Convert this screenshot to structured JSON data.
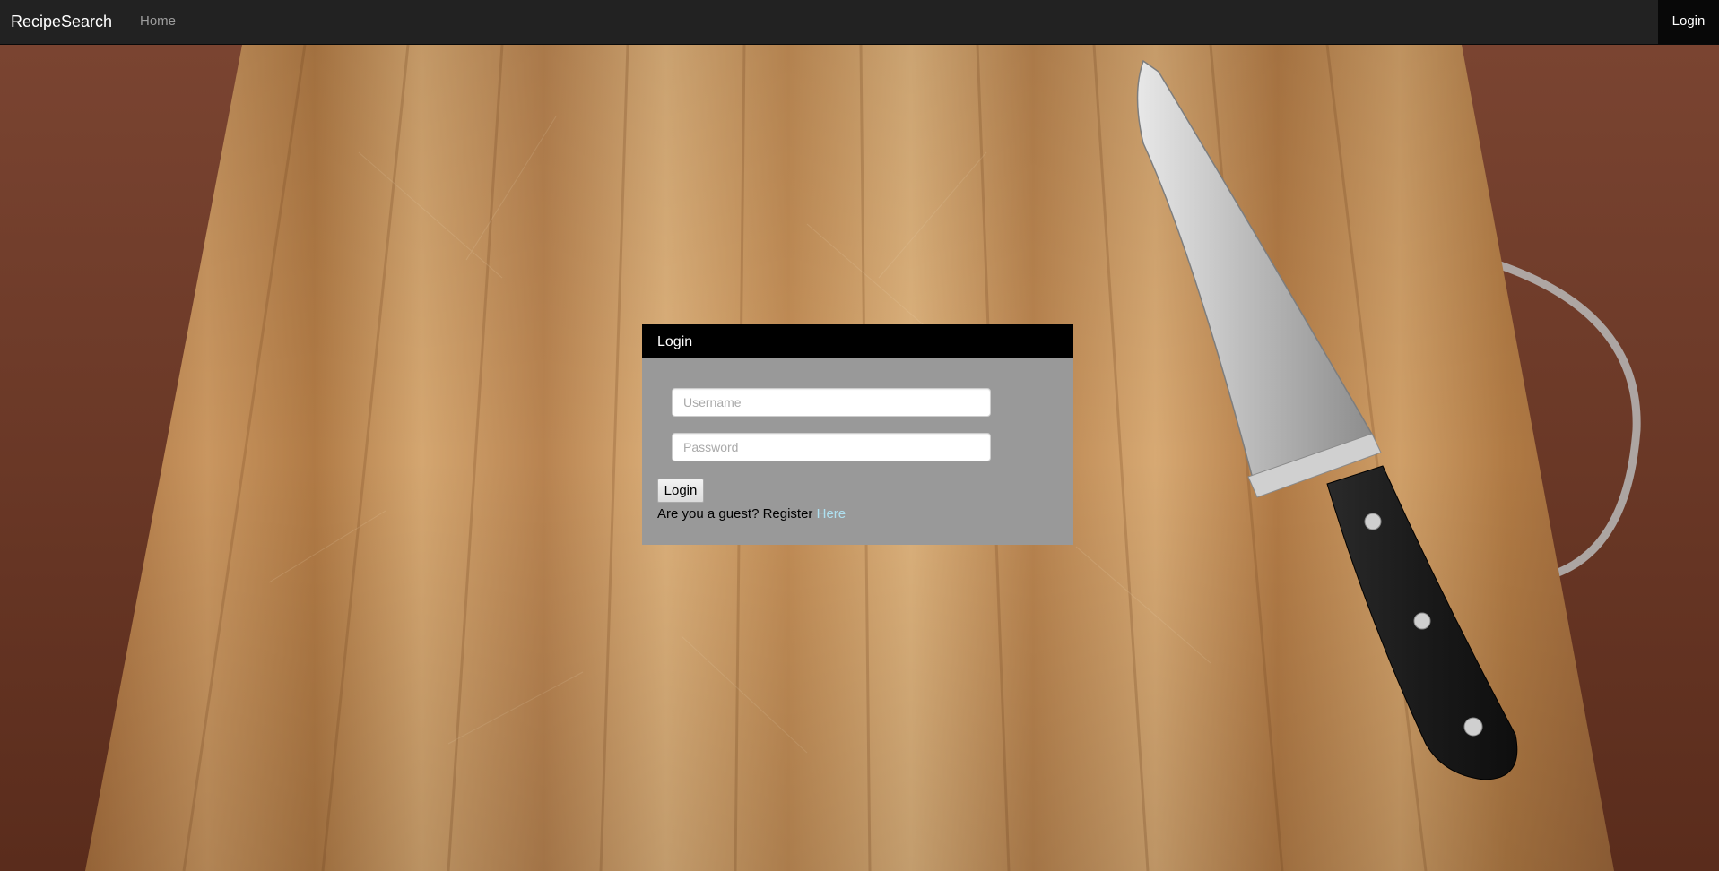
{
  "navbar": {
    "brand": "RecipeSearch",
    "home_label": "Home",
    "login_label": "Login"
  },
  "background": {
    "description_icon": "cutting-board-with-knife"
  },
  "login_panel": {
    "title": "Login",
    "username_placeholder": "Username",
    "password_placeholder": "Password",
    "login_button_label": "Login",
    "guest_text": "Are you a guest? Register",
    "register_link_text": "Here"
  },
  "colors": {
    "navbar_bg": "#222222",
    "navbar_active_bg": "#080808",
    "panel_header_bg": "#000000",
    "panel_body_bg": "#999999",
    "link_color": "#aee0f0"
  }
}
